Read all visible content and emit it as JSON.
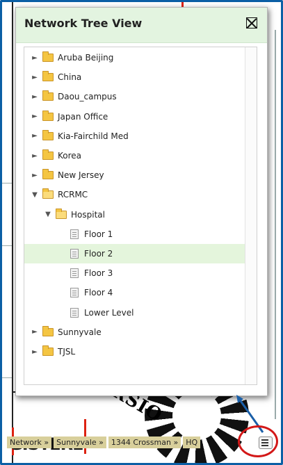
{
  "panel": {
    "title": "Network Tree View"
  },
  "tree": {
    "items": [
      {
        "label": "Aruba Beijing",
        "level": 0,
        "kind": "folder",
        "state": "collapsed"
      },
      {
        "label": "China",
        "level": 0,
        "kind": "folder",
        "state": "collapsed"
      },
      {
        "label": "Daou_campus",
        "level": 0,
        "kind": "folder",
        "state": "collapsed"
      },
      {
        "label": "Japan Office",
        "level": 0,
        "kind": "folder",
        "state": "collapsed"
      },
      {
        "label": "Kia-Fairchild Med",
        "level": 0,
        "kind": "folder",
        "state": "collapsed"
      },
      {
        "label": "Korea",
        "level": 0,
        "kind": "folder",
        "state": "collapsed"
      },
      {
        "label": "New Jersey",
        "level": 0,
        "kind": "folder",
        "state": "collapsed"
      },
      {
        "label": "RCRMC",
        "level": 0,
        "kind": "folder",
        "state": "expanded"
      },
      {
        "label": "Hospital",
        "level": 1,
        "kind": "folder",
        "state": "expanded"
      },
      {
        "label": "Floor 1",
        "level": 2,
        "kind": "page"
      },
      {
        "label": "Floor 2",
        "level": 2,
        "kind": "page",
        "selected": true
      },
      {
        "label": "Floor 3",
        "level": 2,
        "kind": "page"
      },
      {
        "label": "Floor 4",
        "level": 2,
        "kind": "page"
      },
      {
        "label": "Lower Level",
        "level": 2,
        "kind": "page"
      },
      {
        "label": "Sunnyvale",
        "level": 0,
        "kind": "folder",
        "state": "collapsed"
      },
      {
        "label": "TJSL",
        "level": 0,
        "kind": "folder",
        "state": "collapsed"
      }
    ]
  },
  "breadcrumb": {
    "items": [
      "Network »",
      "Sunnyvale »",
      "1344 Crossman »",
      "HQ"
    ]
  },
  "map": {
    "text_fragment": "VERSIO",
    "bottom_text": "GISTERE"
  },
  "icons": {
    "close": "close-box-icon",
    "tree_toggle": "tree-view-icon",
    "annotation_arrow": "arrow-icon"
  },
  "colors": {
    "header_bg": "#e3f4e0",
    "selected_row": "#e4f5dc",
    "crumb_bg": "#d8cf9b",
    "highlight_circle": "#d31818",
    "arrow": "#1a5fa8"
  }
}
